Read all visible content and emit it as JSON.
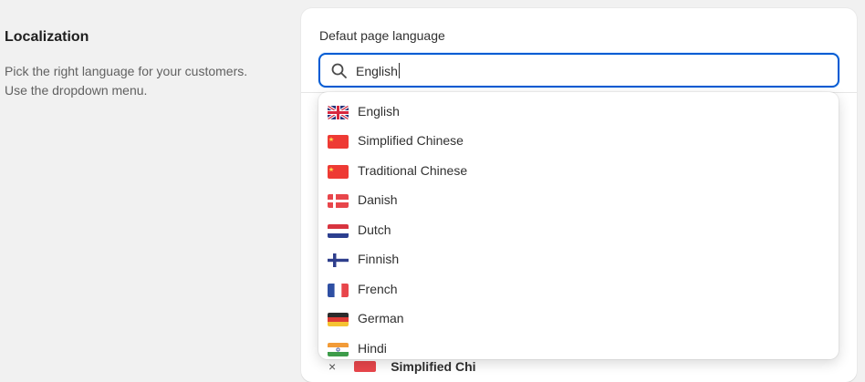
{
  "section": {
    "title": "Localization",
    "description_line1": "Pick the right language for your customers.",
    "description_line2": "Use the dropdown menu."
  },
  "field": {
    "label": "Defaut page language",
    "value": "English"
  },
  "behind": {
    "text": "Simplified Chi"
  },
  "options": [
    {
      "label": "English",
      "flag": "uk-flag-icon"
    },
    {
      "label": "Simplified Chinese",
      "flag": "china-flag-icon"
    },
    {
      "label": "Traditional Chinese",
      "flag": "china-flag-icon"
    },
    {
      "label": "Danish",
      "flag": "denmark-flag-icon"
    },
    {
      "label": "Dutch",
      "flag": "netherlands-flag-icon"
    },
    {
      "label": "Finnish",
      "flag": "finland-flag-icon"
    },
    {
      "label": "French",
      "flag": "france-flag-icon"
    },
    {
      "label": "German",
      "flag": "germany-flag-icon"
    },
    {
      "label": "Hindi",
      "flag": "india-flag-icon"
    }
  ],
  "colors": {
    "focus_border": "#005bd3",
    "background": "#f1f1f1"
  }
}
